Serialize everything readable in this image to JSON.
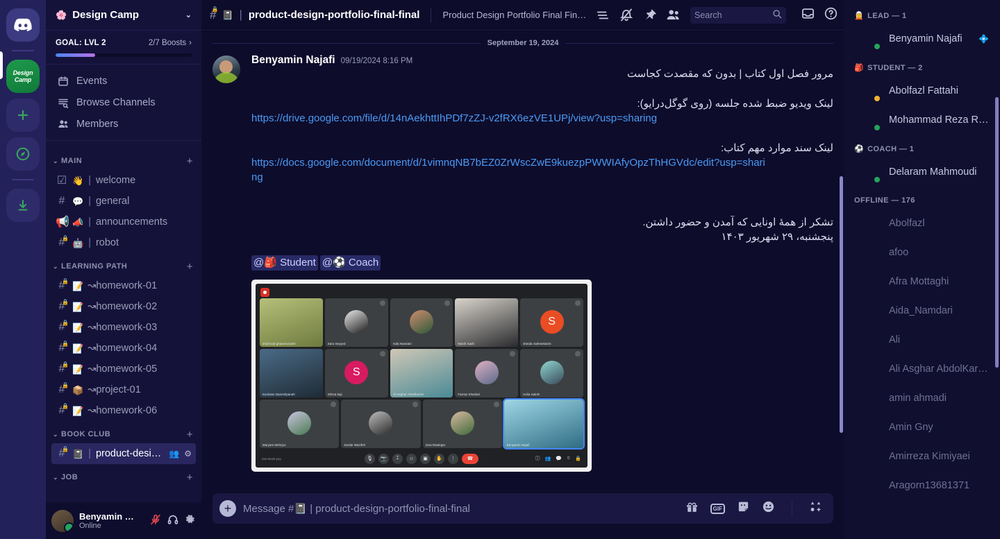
{
  "rail": {
    "home_label": "Discord",
    "active_server": "Design\nCamp",
    "add_label": "+",
    "discover_label": "Explore",
    "download_label": "Download Apps"
  },
  "sidebar": {
    "server_name": "Design Camp",
    "server_emoji": "🌸",
    "boost": {
      "goal_label": "GOAL: LVL 2",
      "count_label": "2/7 Boosts",
      "progress_percent": 29
    },
    "nav": [
      {
        "label": "Events",
        "icon": "calendar-icon"
      },
      {
        "label": "Browse Channels",
        "icon": "browse-channels-icon"
      },
      {
        "label": "Members",
        "icon": "members-icon"
      }
    ],
    "categories": [
      {
        "name": "MAIN",
        "channels": [
          {
            "emoji": "👋",
            "name": "welcome",
            "type": "rules",
            "locked": false,
            "active": false
          },
          {
            "emoji": "💬",
            "name": "general",
            "type": "text",
            "locked": false,
            "active": false
          },
          {
            "emoji": "📣",
            "name": "announcements",
            "type": "announcement",
            "locked": false,
            "active": false
          },
          {
            "emoji": "🤖",
            "name": "robot",
            "type": "text",
            "locked": true,
            "active": false
          }
        ]
      },
      {
        "name": "LEARNING PATH",
        "channels": [
          {
            "emoji": "📝",
            "name": "↝homework-01",
            "type": "text",
            "locked": true,
            "active": false
          },
          {
            "emoji": "📝",
            "name": "↝homework-02",
            "type": "text",
            "locked": true,
            "active": false
          },
          {
            "emoji": "📝",
            "name": "↝homework-03",
            "type": "text",
            "locked": true,
            "active": false
          },
          {
            "emoji": "📝",
            "name": "↝homework-04",
            "type": "text",
            "locked": true,
            "active": false
          },
          {
            "emoji": "📝",
            "name": "↝homework-05",
            "type": "text",
            "locked": true,
            "active": false
          },
          {
            "emoji": "📦",
            "name": "↝project-01",
            "type": "text",
            "locked": true,
            "active": false
          },
          {
            "emoji": "📝",
            "name": "↝homework-06",
            "type": "text",
            "locked": true,
            "active": false
          }
        ]
      },
      {
        "name": "BOOK CLUB",
        "channels": [
          {
            "emoji": "📓",
            "name": "product-desi…",
            "type": "text",
            "locked": true,
            "active": true
          }
        ]
      },
      {
        "name": "JOB",
        "channels": []
      }
    ],
    "user": {
      "name": "Benyamin …",
      "status": "Online",
      "mic_state": "muted",
      "icons": [
        "mic-muted-icon",
        "headset-icon",
        "settings-gear-icon"
      ]
    }
  },
  "topbar": {
    "channel_emoji": "📓",
    "channel_name": "product-design-portfolio-final-final",
    "topic": "Product Design Portfolio Final Final Make a product design portfolio that lands dr…",
    "icons": [
      "threads-icon",
      "notification-muted-icon",
      "pinned-messages-icon",
      "member-list-icon"
    ],
    "search_placeholder": "Search",
    "right_icons": [
      "inbox-icon",
      "help-icon"
    ]
  },
  "messages": {
    "date_separator": "September 19, 2024",
    "items": [
      {
        "author": "Benyamin Najafi",
        "timestamp": "09/19/2024 8:16 PM",
        "line1": "مرور فصل اول کتاب | بدون که مقصدت کجاست",
        "line2": "لینک ویدیو ضبط شده جلسه (روی گوگل‌درایو):",
        "link1": "https://drive.google.com/file/d/14nAekhttIhPDf7zZJ-v2fRX6ezVE1UPj/view?usp=sharing",
        "line3": "لینک سند موارد مهم کتاب:",
        "link2": "https://docs.google.com/document/d/1vimnqNB7bEZ0ZrWscZwE9kuezpPWWIAfyOpzThHGVdc/edit?usp=sharing",
        "line4": "تشکر از همهٔ اونایی که آمدن و حضور داشتن.",
        "line5": "پنجشنبه، ۲۹ شهریور ۱۴۰۳",
        "mentions": [
          {
            "emoji": "🎒",
            "label": "Student"
          },
          {
            "emoji": "⚽",
            "label": "Coach"
          }
        ],
        "attachment": {
          "type": "image",
          "alt": "Google Meet call screenshot",
          "meeting_id": "nsx-smck-yxy",
          "participants": [
            {
              "name": "shahrzad ghasemzadeh",
              "mode": "video"
            },
            {
              "name": "Sara Seyyed",
              "mode": "avatar"
            },
            {
              "name": "Aida Namdari",
              "mode": "avatar"
            },
            {
              "name": "Masih Sadri",
              "mode": "video"
            },
            {
              "name": "sheida rashmekarim",
              "mode": "initial",
              "initial": "S"
            },
            {
              "name": "Keshane Daneshpanah",
              "mode": "video"
            },
            {
              "name": "Shima kaji",
              "mode": "initial",
              "initial": "S"
            },
            {
              "name": "Ali asghar Abdolkarimi",
              "mode": "video"
            },
            {
              "name": "Farnaz Khanlari",
              "mode": "avatar"
            },
            {
              "name": "Helia Salehi",
              "mode": "avatar"
            },
            {
              "name": "Maryam Mehrjoo",
              "mode": "avatar"
            },
            {
              "name": "Sardar Wazifeh",
              "mode": "avatar"
            },
            {
              "name": "Zara Rastegar",
              "mode": "avatar"
            },
            {
              "name": "Benyamin Najafi",
              "mode": "video",
              "selected": true
            }
          ]
        }
      }
    ]
  },
  "composer": {
    "placeholder": "Message #📓 | product-design-portfolio-final-final",
    "icons": [
      "gift-icon",
      "gif-icon",
      "sticker-icon",
      "emoji-icon",
      "apps-icon"
    ],
    "gif_label": "GIF"
  },
  "members": {
    "groups": [
      {
        "emoji": "🧝",
        "label": "LEAD — 1",
        "offline": false,
        "people": [
          {
            "name": "Benyamin Najafi",
            "status": "online",
            "badge": "💠",
            "avatar_colors": [
              "#7e8fa0",
              "#2c3a46"
            ]
          }
        ]
      },
      {
        "emoji": "🎒",
        "label": "STUDENT — 2",
        "offline": false,
        "people": [
          {
            "name": "Abolfazl Fattahi",
            "status": "idle",
            "avatar_colors": [
              "#e8e8e8",
              "#2a2a2a"
            ]
          },
          {
            "name": "Mohammad Reza Ra…",
            "status": "online",
            "avatar_colors": [
              "#9a9a9a",
              "#4a4a4a"
            ]
          }
        ]
      },
      {
        "emoji": "⚽",
        "label": "COACH — 1",
        "offline": false,
        "people": [
          {
            "name": "Delaram Mahmoudi",
            "status": "online",
            "avatar_colors": [
              "#e0b98a",
              "#6d5336"
            ]
          }
        ]
      },
      {
        "emoji": "",
        "label": "OFFLINE — 176",
        "offline": true,
        "people": [
          {
            "name": "Abolfazl",
            "avatar_colors": [
              "#c97f5a",
              "#5c2f1e"
            ]
          },
          {
            "name": "afoo",
            "avatar_colors": [
              "#6fd0cf",
              "#d9cb5e"
            ]
          },
          {
            "name": "Afra Mottaghi",
            "avatar_colors": [
              "#8d97ab",
              "#3a4050"
            ]
          },
          {
            "name": "Aida_Namdari",
            "avatar_colors": [
              "#c58f77",
              "#4a2e28"
            ]
          },
          {
            "name": "Ali",
            "avatar_colors": [
              "#3a5ad9",
              "#35c06a"
            ]
          },
          {
            "name": "Ali Asghar AbdolKari…",
            "avatar_colors": [
              "#a9b2bd",
              "#4d5560"
            ]
          },
          {
            "name": "amin ahmadi",
            "avatar_colors": [
              "#3b49c9",
              "#e8c54a"
            ]
          },
          {
            "name": "Amin Gny",
            "avatar_colors": [
              "#f0f0f0",
              "#303030"
            ]
          },
          {
            "name": "Amirreza Kimiyaei",
            "avatar_colors": [
              "#8a8f9b",
              "#2d3138"
            ]
          },
          {
            "name": "Aragorn13681371",
            "avatar_colors": [
              "#5856d6",
              "#d8457e"
            ]
          }
        ]
      }
    ]
  }
}
